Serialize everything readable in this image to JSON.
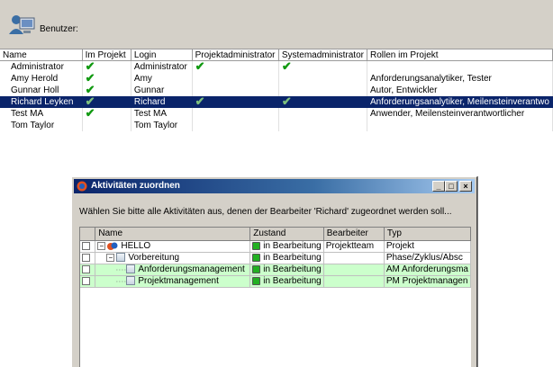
{
  "header": {
    "title": "Benutzer:",
    "icon": "users-icon"
  },
  "users_table": {
    "columns": [
      "Name",
      "Im Projekt",
      "Login",
      "Projektadministrator",
      "Systemadministrator",
      "Rollen im Projekt"
    ],
    "rows": [
      {
        "name": "Administrator",
        "im_projekt": true,
        "login": "Administrator",
        "projektadmin": true,
        "systemadmin": true,
        "rollen": "",
        "selected": false
      },
      {
        "name": "Amy Herold",
        "im_projekt": true,
        "login": "Amy",
        "projektadmin": false,
        "systemadmin": false,
        "rollen": "Anforderungsanalytiker, Tester",
        "selected": false
      },
      {
        "name": "Gunnar Holl",
        "im_projekt": true,
        "login": "Gunnar",
        "projektadmin": false,
        "systemadmin": false,
        "rollen": "Autor, Entwickler",
        "selected": false
      },
      {
        "name": "Richard Leyken",
        "im_projekt": true,
        "login": "Richard",
        "projektadmin": true,
        "systemadmin": true,
        "rollen": "Anforderungsanalytiker, Meilensteinverantwo",
        "selected": true
      },
      {
        "name": "Test MA",
        "im_projekt": true,
        "login": "Test MA",
        "projektadmin": false,
        "systemadmin": false,
        "rollen": "Anwender, Meilensteinverantwortlicher",
        "selected": false
      },
      {
        "name": "Tom Taylor",
        "im_projekt": false,
        "login": "Tom Taylor",
        "projektadmin": false,
        "systemadmin": false,
        "rollen": "",
        "selected": false
      }
    ]
  },
  "dialog": {
    "title": "Aktivitäten zuordnen",
    "buttons": {
      "minimize": "_",
      "maximize": "□",
      "close": "×"
    },
    "instruction": "Wählen Sie bitte alle Aktivitäten aus, denen der Bearbeiter 'Richard' zugeordnet werden soll...",
    "columns": [
      "Name",
      "Zustand",
      "Bearbeiter",
      "Typ"
    ],
    "rows": [
      {
        "name": "HELLO",
        "zustand": "in Bearbeitung",
        "bearbeiter": "Projektteam",
        "typ": "Projekt",
        "level": 0,
        "icon": "project-icon",
        "expander": "⊟",
        "highlight": false
      },
      {
        "name": "Vorbereitung",
        "zustand": "in Bearbeitung",
        "bearbeiter": "",
        "typ": "Phase/Zyklus/Absc",
        "level": 1,
        "icon": "document-icon",
        "expander": "⊟",
        "highlight": false
      },
      {
        "name": "Anforderungsmanagement",
        "zustand": "in Bearbeitung",
        "bearbeiter": "",
        "typ": "AM Anforderungsma",
        "level": 2,
        "icon": "document-icon",
        "expander": "",
        "highlight": true
      },
      {
        "name": "Projektmanagement",
        "zustand": "in Bearbeitung",
        "bearbeiter": "",
        "typ": "PM Projektmanagen",
        "level": 2,
        "icon": "document-icon",
        "expander": "",
        "highlight": true
      }
    ]
  },
  "colors": {
    "selection": "#0a246a",
    "highlight_row": "#ccffcc",
    "check": "#119911",
    "status_green": "#22b022",
    "dialog_face": "#d4d0c8"
  }
}
